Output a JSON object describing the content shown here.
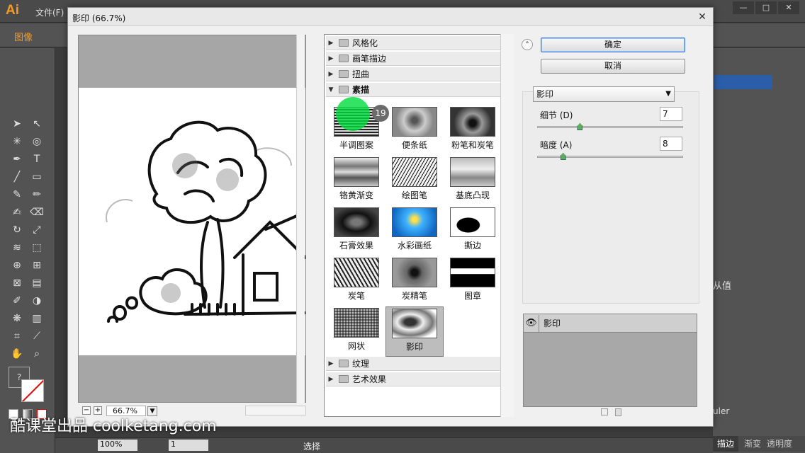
{
  "app": {
    "logo": "Ai",
    "menu_first": "文件(F)",
    "control_label": "图像",
    "win_min": "—",
    "win_max": "□",
    "win_close": "✕"
  },
  "dialog": {
    "title": "影印 (66.7%)",
    "close": "✕"
  },
  "preview": {
    "zoom": "66.7%",
    "zoom_minus": "−",
    "zoom_plus": "+"
  },
  "filters": {
    "categories_top": [
      {
        "label": "风格化",
        "state": "collapsed"
      },
      {
        "label": "画笔描边",
        "state": "collapsed"
      },
      {
        "label": "扭曲",
        "state": "collapsed"
      },
      {
        "label": "素描",
        "state": "expanded"
      }
    ],
    "thumbnails": [
      {
        "label": "半调图案"
      },
      {
        "label": "便条纸"
      },
      {
        "label": "粉笔和炭笔"
      },
      {
        "label": "铬黄渐变"
      },
      {
        "label": "绘图笔"
      },
      {
        "label": "基底凸现"
      },
      {
        "label": "石膏效果"
      },
      {
        "label": "水彩画纸"
      },
      {
        "label": "撕边"
      },
      {
        "label": "炭笔"
      },
      {
        "label": "炭精笔"
      },
      {
        "label": "图章"
      },
      {
        "label": "网状"
      },
      {
        "label": "影印",
        "selected": true
      }
    ],
    "categories_bottom": [
      {
        "label": "纹理",
        "state": "collapsed"
      },
      {
        "label": "艺术效果",
        "state": "collapsed"
      }
    ]
  },
  "actions": {
    "ok_label": "确定",
    "cancel_label": "取消",
    "collapse_icon": "⌃"
  },
  "settings": {
    "filter_select": "影印",
    "detail": {
      "label": "细节 (D)",
      "value": "7",
      "level": 0.28
    },
    "darkness": {
      "label": "暗度 (A)",
      "value": "8",
      "level": 0.16
    }
  },
  "layers": {
    "current": "影印",
    "eye_icon": "👁"
  },
  "cursor_badge": "19",
  "bottom": {
    "zoom": "100%",
    "page": "1",
    "status": "选择"
  },
  "right_panel": {
    "text1": "从值",
    "tab1": "描边",
    "tab2": "渐变",
    "tab3": "透明度",
    "tab_ruler": "uler"
  },
  "watermark": "酷课堂出品 coolketang.com",
  "colors": {
    "ai_orange": "#f59a23",
    "selected_thumb": "#bdbdbd",
    "cursor_green": "#00dc3c"
  }
}
